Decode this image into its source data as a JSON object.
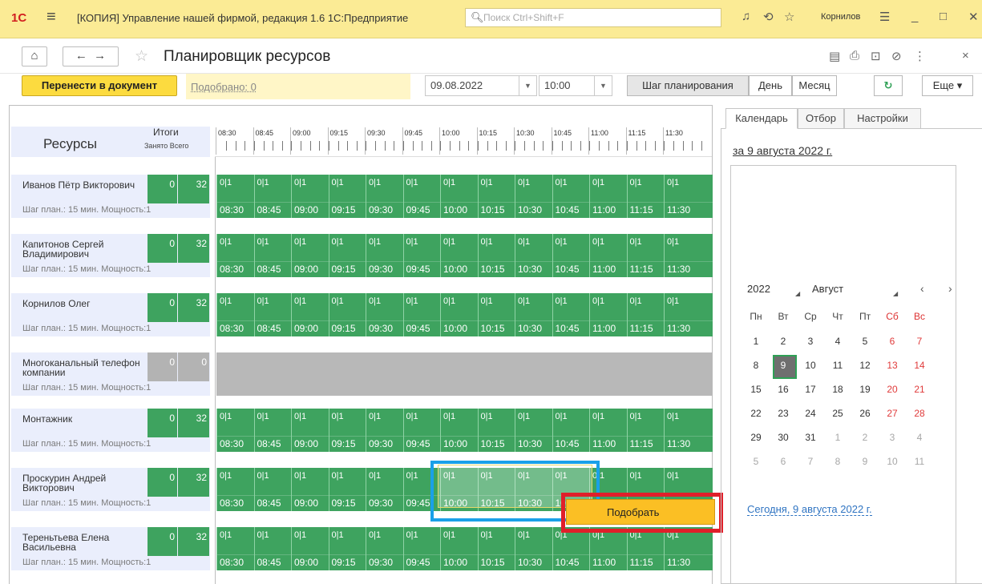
{
  "app": {
    "logo": "1С",
    "title": "[КОПИЯ] Управление нашей фирмой, редакция 1.6 1С:Предприятие",
    "search_placeholder": "Поиск Ctrl+Shift+F",
    "user": "Корнилов"
  },
  "page": {
    "title": "Планировщик ресурсов"
  },
  "toolbar": {
    "transfer_label": "Перенести в документ",
    "selected_label": "Подобрано: 0",
    "date_value": "09.08.2022",
    "time_value": "10:00",
    "mode_step": "Шаг планирования",
    "mode_day": "День",
    "mode_month": "Месяц",
    "more_label": "Еще"
  },
  "grid": {
    "resources_header": "Ресурсы",
    "totals_header": "Итоги",
    "totals_sub": "Занято Всего",
    "times": [
      "08:30",
      "08:45",
      "09:00",
      "09:15",
      "09:30",
      "09:45",
      "10:00",
      "10:15",
      "10:30",
      "10:45",
      "11:00",
      "11:15",
      "11:30"
    ],
    "cell_value": "0|1",
    "step_text": "Шаг план.: 15 мин. Мощность:1",
    "rows": [
      {
        "name": "Иванов Пётр Викторович",
        "busy": "0",
        "total": "32"
      },
      {
        "name": "Капитонов Сергей Владимирович",
        "busy": "0",
        "total": "32"
      },
      {
        "name": "Корнилов Олег",
        "busy": "0",
        "total": "32"
      },
      {
        "name": "Многоканальный телефон компании",
        "busy": "0",
        "total": "0"
      },
      {
        "name": "Монтажник",
        "busy": "0",
        "total": "32"
      },
      {
        "name": "Проскурин Андрей Викторович",
        "busy": "0",
        "total": "32"
      },
      {
        "name": "Тереньтьева Елена Васильевна",
        "busy": "0",
        "total": "32"
      }
    ],
    "pick_label": "Подобрать"
  },
  "right": {
    "tabs": [
      "Календарь",
      "Отбор",
      "Настройки"
    ],
    "date_link": "за 9 августа 2022 г.",
    "cal_year": "2022",
    "cal_month": "Август",
    "weekdays": [
      "Пн",
      "Вт",
      "Ср",
      "Чт",
      "Пт",
      "Сб",
      "Вс"
    ],
    "weeks": [
      [
        "1",
        "2",
        "3",
        "4",
        "5",
        "6",
        "7"
      ],
      [
        "8",
        "9",
        "10",
        "11",
        "12",
        "13",
        "14"
      ],
      [
        "15",
        "16",
        "17",
        "18",
        "19",
        "20",
        "21"
      ],
      [
        "22",
        "23",
        "24",
        "25",
        "26",
        "27",
        "28"
      ],
      [
        "29",
        "30",
        "31",
        "1",
        "2",
        "3",
        "4"
      ],
      [
        "5",
        "6",
        "7",
        "8",
        "9",
        "10",
        "11"
      ]
    ],
    "today_link": "Сегодня, 9 августа 2022 г."
  },
  "colors": {
    "accent": "#fcdb3f",
    "busy_green": "#3ea35f",
    "selection_blue": "#1aa0e8",
    "highlight_red": "#e01f2a"
  }
}
